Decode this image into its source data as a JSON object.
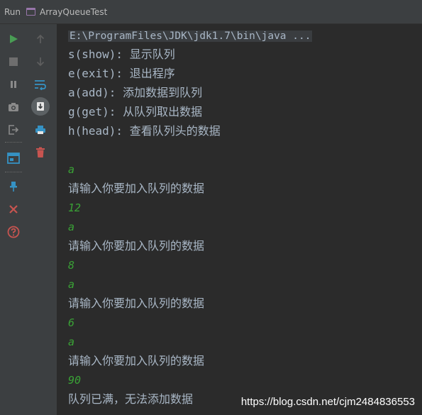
{
  "header": {
    "tool_window": "Run",
    "config_name": "ArrayQueueTest"
  },
  "toolbar": {
    "icons": [
      "run-icon",
      "arrow-up-icon",
      "stop-icon",
      "arrow-down-icon",
      "pause-icon",
      "soft-wrap-icon",
      "camera-icon",
      "scroll-to-end-icon",
      "exit-icon",
      "print-icon",
      "trash-icon",
      "layout-icon",
      "pin-icon",
      "close-icon",
      "help-icon"
    ],
    "colors": {
      "run": "#499c54",
      "close": "#c75450",
      "help": "#c75450",
      "print": "#3592c4",
      "trash": "#c75450"
    }
  },
  "console": {
    "command": "E:\\ProgramFiles\\JDK\\jdk1.7\\bin\\java ...",
    "menu": [
      "s(show): 显示队列",
      "e(exit): 退出程序",
      "a(add): 添加数据到队列",
      "g(get): 从队列取出数据",
      "h(head): 查看队列头的数据"
    ],
    "session": [
      {
        "kind": "in",
        "text": "a"
      },
      {
        "kind": "out",
        "text": "请输入你要加入队列的数据"
      },
      {
        "kind": "in",
        "text": "12"
      },
      {
        "kind": "in",
        "text": "a"
      },
      {
        "kind": "out",
        "text": "请输入你要加入队列的数据"
      },
      {
        "kind": "in",
        "text": "8"
      },
      {
        "kind": "in",
        "text": "a"
      },
      {
        "kind": "out",
        "text": "请输入你要加入队列的数据"
      },
      {
        "kind": "in",
        "text": "6"
      },
      {
        "kind": "in",
        "text": "a"
      },
      {
        "kind": "out",
        "text": "请输入你要加入队列的数据"
      },
      {
        "kind": "in",
        "text": "90"
      },
      {
        "kind": "out",
        "text": "队列已满，无法添加数据"
      }
    ],
    "colors": {
      "output": "#a9b7c6",
      "user_input": "#3aa236"
    }
  },
  "watermark": "https://blog.csdn.net/cjm2484836553"
}
